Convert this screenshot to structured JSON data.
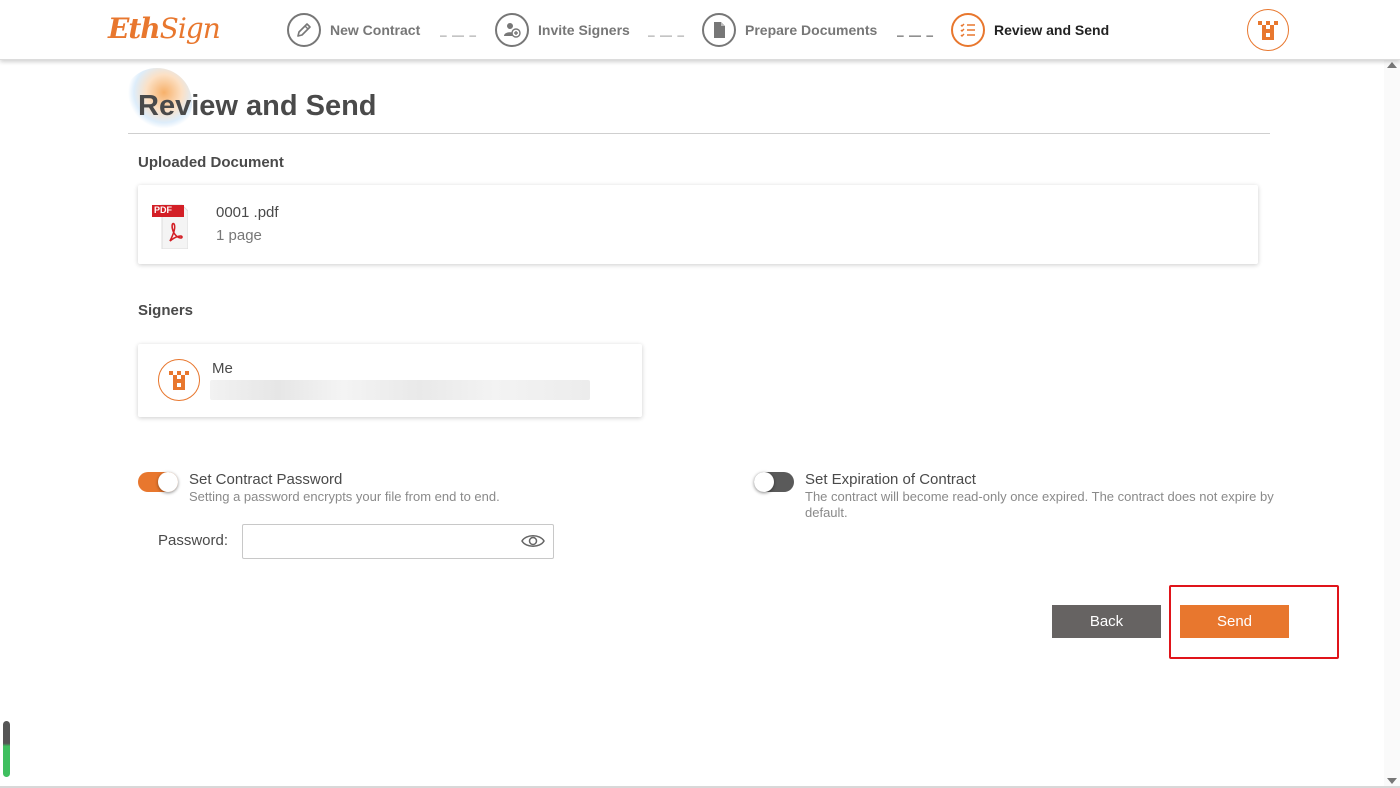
{
  "app": {
    "logo_a": "Eth",
    "logo_b": "Sign"
  },
  "steps": [
    {
      "label": "New Contract",
      "icon": "pen-icon",
      "state": "complete"
    },
    {
      "label": "Invite Signers",
      "icon": "users-add-icon",
      "state": "complete"
    },
    {
      "label": "Prepare Documents",
      "icon": "document-icon",
      "state": "complete"
    },
    {
      "label": "Review and Send",
      "icon": "checklist-icon",
      "state": "active"
    }
  ],
  "step_separator": "– — –",
  "page": {
    "title": "Review and Send"
  },
  "uploaded_document": {
    "section_label": "Uploaded Document",
    "name": "0001 .pdf",
    "pages": "1 page",
    "icon": "pdf-icon",
    "icon_text": "PDF"
  },
  "signers": {
    "section_label": "Signers",
    "items": [
      {
        "name": "Me",
        "address_hidden": true
      }
    ]
  },
  "options": {
    "password": {
      "title": "Set Contract Password",
      "description": "Setting a password encrypts your file from end to end.",
      "enabled": true,
      "field_label": "Password:",
      "value": "",
      "placeholder": ""
    },
    "expiration": {
      "title": "Set Expiration of Contract",
      "description": "The contract will become read-only once expired. The contract does not expire by default.",
      "enabled": false
    }
  },
  "actions": {
    "back_label": "Back",
    "send_label": "Send"
  },
  "colors": {
    "accent": "#e8772e",
    "secondary_button": "#666362",
    "highlight": "#e0141a"
  }
}
